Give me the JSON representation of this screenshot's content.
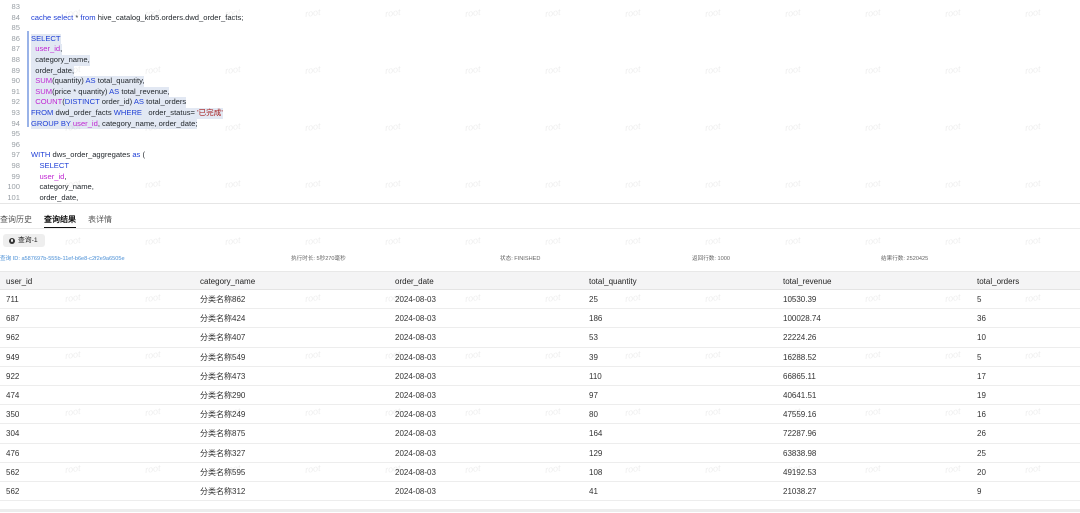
{
  "editor": {
    "lines": [
      {
        "n": "83",
        "parts": []
      },
      {
        "n": "84",
        "parts": [
          [
            "kw",
            "cache select "
          ],
          [
            "",
            "* "
          ],
          [
            "kw",
            "from "
          ],
          [
            "",
            "hive_catalog_krb5.orders.dwd_order_facts;"
          ]
        ]
      },
      {
        "n": "85",
        "parts": []
      },
      {
        "n": "86",
        "hl": true,
        "parts": [
          [
            "kw",
            "SELECT"
          ]
        ]
      },
      {
        "n": "87",
        "hl": true,
        "parts": [
          [
            "",
            "  "
          ],
          [
            "id",
            "user_id"
          ],
          [
            "",
            ","
          ]
        ]
      },
      {
        "n": "88",
        "hl": true,
        "parts": [
          [
            "",
            "  category_name,"
          ]
        ]
      },
      {
        "n": "89",
        "hl": true,
        "parts": [
          [
            "",
            "  order_date,"
          ]
        ]
      },
      {
        "n": "90",
        "hl": true,
        "parts": [
          [
            "",
            "  "
          ],
          [
            "fn",
            "SUM"
          ],
          [
            "",
            "(quantity) "
          ],
          [
            "kw",
            "AS "
          ],
          [
            "",
            "total_quantity,"
          ]
        ]
      },
      {
        "n": "91",
        "hl": true,
        "parts": [
          [
            "",
            "  "
          ],
          [
            "fn",
            "SUM"
          ],
          [
            "",
            "(price * quantity) "
          ],
          [
            "kw",
            "AS "
          ],
          [
            "",
            "total_revenue,"
          ]
        ]
      },
      {
        "n": "92",
        "hl": true,
        "parts": [
          [
            "",
            "  "
          ],
          [
            "fn",
            "COUNT"
          ],
          [
            "",
            "("
          ],
          [
            "kw",
            "DISTINCT "
          ],
          [
            "",
            "order_id) "
          ],
          [
            "kw",
            "AS "
          ],
          [
            "",
            "total_orders"
          ]
        ]
      },
      {
        "n": "93",
        "hl": true,
        "parts": [
          [
            "kw",
            "FROM "
          ],
          [
            "",
            "dwd_order_facts "
          ],
          [
            "kw",
            "WHERE "
          ],
          [
            "",
            "  order_status= "
          ],
          [
            "str",
            "'已完成'"
          ]
        ]
      },
      {
        "n": "94",
        "hl": true,
        "parts": [
          [
            "kw",
            "GROUP BY "
          ],
          [
            "id",
            "user_id"
          ],
          [
            "",
            ", category_name, order_date;"
          ]
        ]
      },
      {
        "n": "95",
        "parts": []
      },
      {
        "n": "96",
        "parts": []
      },
      {
        "n": "97",
        "parts": [
          [
            "kw",
            "WITH "
          ],
          [
            "",
            "dws_order_aggregates "
          ],
          [
            "kw",
            "as "
          ],
          [
            "",
            "("
          ]
        ]
      },
      {
        "n": "98",
        "parts": [
          [
            "",
            "    "
          ],
          [
            "kw",
            "SELECT"
          ]
        ]
      },
      {
        "n": "99",
        "parts": [
          [
            "",
            "    "
          ],
          [
            "id",
            "user_id"
          ],
          [
            "",
            ","
          ]
        ]
      },
      {
        "n": "100",
        "parts": [
          [
            "",
            "    category_name,"
          ]
        ]
      },
      {
        "n": "101",
        "parts": [
          [
            "",
            "    order_date,"
          ]
        ]
      }
    ]
  },
  "tabs": [
    {
      "label": "查询历史",
      "active": false
    },
    {
      "label": "查询结果",
      "active": true
    },
    {
      "label": "表详情",
      "active": false
    }
  ],
  "query_chip": {
    "label": "查询-1",
    "icon": "settings-icon"
  },
  "meta": {
    "query_id": "查询 ID: a587697b-555b-11ef-b6e8-c2f2e9a6505e",
    "exec_time": "执行时长: 5秒270毫秒",
    "status": "状态: FINISHED",
    "returned_rows": "返回行数: 1000",
    "result_rows": "结果行数: 2520425"
  },
  "table": {
    "columns": [
      "user_id",
      "category_name",
      "order_date",
      "total_quantity",
      "total_revenue",
      "total_orders"
    ],
    "rows": [
      [
        "711",
        "分类名称862",
        "2024-08-03",
        "25",
        "10530.39",
        "5"
      ],
      [
        "687",
        "分类名称424",
        "2024-08-03",
        "186",
        "100028.74",
        "36"
      ],
      [
        "962",
        "分类名称407",
        "2024-08-03",
        "53",
        "22224.26",
        "10"
      ],
      [
        "949",
        "分类名称549",
        "2024-08-03",
        "39",
        "16288.52",
        "5"
      ],
      [
        "922",
        "分类名称473",
        "2024-08-03",
        "110",
        "66865.11",
        "17"
      ],
      [
        "474",
        "分类名称290",
        "2024-08-03",
        "97",
        "40641.51",
        "19"
      ],
      [
        "350",
        "分类名称249",
        "2024-08-03",
        "80",
        "47559.16",
        "16"
      ],
      [
        "304",
        "分类名称875",
        "2024-08-03",
        "164",
        "72287.96",
        "26"
      ],
      [
        "476",
        "分类名称327",
        "2024-08-03",
        "129",
        "63838.98",
        "25"
      ],
      [
        "562",
        "分类名称595",
        "2024-08-03",
        "108",
        "49192.53",
        "20"
      ],
      [
        "562",
        "分类名称312",
        "2024-08-03",
        "41",
        "21038.27",
        "9"
      ]
    ]
  },
  "watermark": "root"
}
